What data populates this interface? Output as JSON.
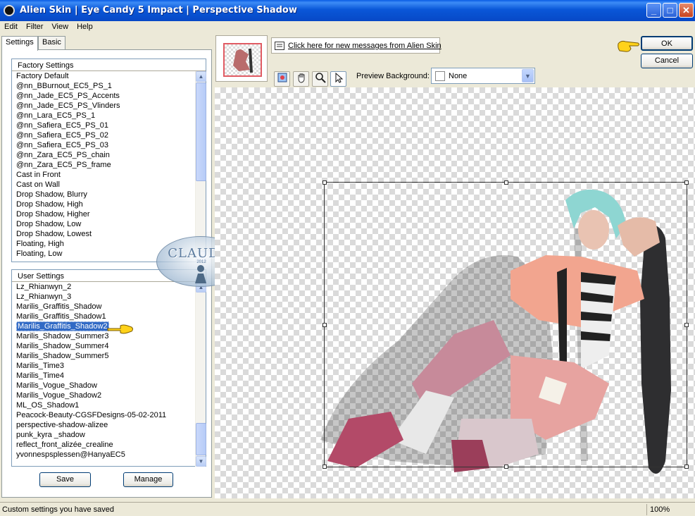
{
  "window": {
    "title": "Alien Skin | Eye Candy 5 Impact | Perspective Shadow",
    "buttons": {
      "minimize": "_",
      "maximize": "□",
      "close": "✕"
    }
  },
  "menu": [
    "Edit",
    "Filter",
    "View",
    "Help"
  ],
  "tabs": [
    "Settings",
    "Basic"
  ],
  "factory_settings": {
    "header": "Factory Settings",
    "items": [
      "Factory Default",
      "@nn_BBurnout_EC5_PS_1",
      "@nn_Jade_EC5_PS_Accents",
      "@nn_Jade_EC5_PS_Vlinders",
      "@nn_Lara_EC5_PS_1",
      "@nn_Safiera_EC5_PS_01",
      "@nn_Safiera_EC5_PS_02",
      "@nn_Safiera_EC5_PS_03",
      "@nn_Zara_EC5_PS_chain",
      "@nn_Zara_EC5_PS_frame",
      "Cast in Front",
      "Cast on Wall",
      "Drop Shadow, Blurry",
      "Drop Shadow, High",
      "Drop Shadow, Higher",
      "Drop Shadow, Low",
      "Drop Shadow, Lowest",
      "Floating, High",
      "Floating, Low"
    ]
  },
  "user_settings": {
    "header": "User Settings",
    "selected": "Marilis_Graffitis_Shadow2",
    "items": [
      "Lz_Rhianwyn_2",
      "Lz_Rhianwyn_3",
      "Marilis_Graffitis_Shadow",
      "Marilis_Graffitis_Shadow1",
      "Marilis_Graffitis_Shadow2",
      "Marilis_Shadow_Summer3",
      "Marilis_Shadow_Summer4",
      "Marilis_Shadow_Summer5",
      "Marilis_Time3",
      "Marilis_Time4",
      "Marilis_Vogue_Shadow",
      "Marilis_Vogue_Shadow2",
      "ML_OS_Shadow1",
      "Peacock-Beauty-CGSFDesigns-05-02-2011",
      "perspective-shadow-alizee",
      "punk_kyra _shadow",
      "reflect_front_alizée_crealine",
      "yvonnespsplessen@HanyaEC5"
    ]
  },
  "buttons": {
    "save": "Save",
    "manage": "Manage",
    "ok": "OK",
    "cancel": "Cancel"
  },
  "message_link": "Click here for new messages from Alien Skin",
  "preview_background": {
    "label": "Preview Background:",
    "value": "None"
  },
  "watermark": {
    "text": "CLAUDIA",
    "sub": "2012"
  },
  "status": {
    "text": "Custom settings you have saved",
    "zoom": "100%"
  },
  "colors": {
    "selection": "#316AC5",
    "title_bar": "#0A57D8",
    "thumb_border": "#E05B63"
  }
}
